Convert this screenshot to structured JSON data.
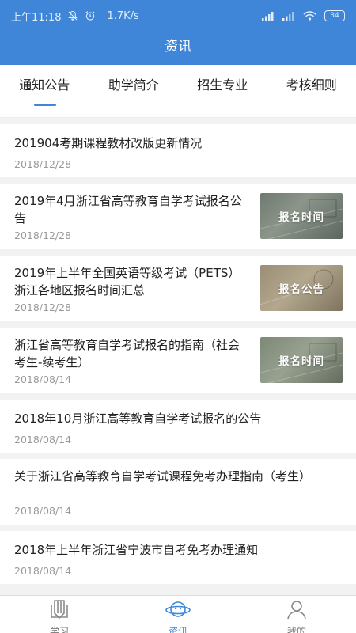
{
  "status_bar": {
    "time": "上午11:18",
    "speed": "1.7K/s",
    "battery": "34"
  },
  "header": {
    "title": "资讯"
  },
  "tabs": [
    {
      "label": "通知公告",
      "active": true
    },
    {
      "label": "助学简介",
      "active": false
    },
    {
      "label": "招生专业",
      "active": false
    },
    {
      "label": "考核细则",
      "active": false
    }
  ],
  "articles": [
    {
      "title": "201904考期课程教材改版更新情况",
      "date": "2018/12/28"
    },
    {
      "title": "2019年4月浙江省高等教育自学考试报名公告",
      "date": "2018/12/28",
      "thumb": "报名时间"
    },
    {
      "title": "2019年上半年全国英语等级考试（PETS）浙江各地区报名时间汇总",
      "date": "2018/12/28",
      "thumb": "报名公告"
    },
    {
      "title": "浙江省高等教育自学考试报名的指南（社会考生-续考生）",
      "date": "2018/08/14",
      "thumb": "报名时间"
    },
    {
      "title": "2018年10月浙江高等教育自学考试报名的公告",
      "date": "2018/08/14"
    },
    {
      "title": "关于浙江省高等教育自学考试课程免考办理指南（考生）",
      "date": "2018/08/14"
    },
    {
      "title": "2018年上半年浙江省宁波市自考免考办理通知",
      "date": "2018/08/14"
    }
  ],
  "bottom_nav": [
    {
      "label": "学习",
      "icon": "book-pencil-icon",
      "active": false
    },
    {
      "label": "资讯",
      "icon": "planet-icon",
      "active": true
    },
    {
      "label": "我的",
      "icon": "person-icon",
      "active": false
    }
  ],
  "colors": {
    "primary": "#3f86d9",
    "background": "#f2f2f2",
    "text": "#222222",
    "muted": "#999999"
  }
}
